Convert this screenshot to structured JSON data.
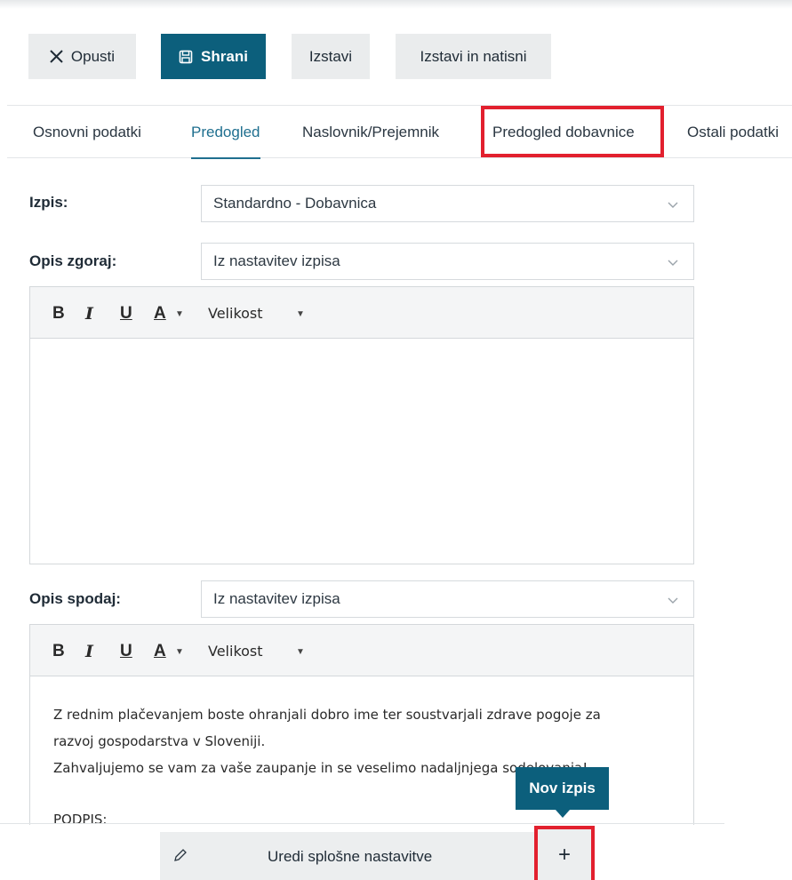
{
  "toolbar": {
    "discard_label": "Opusti",
    "save_label": "Shrani",
    "issue_label": "Izstavi",
    "issue_print_label": "Izstavi in natisni"
  },
  "tabs": [
    {
      "label": "Osnovni podatki"
    },
    {
      "label": "Predogled",
      "active": true
    },
    {
      "label": "Naslovnik/Prejemnik"
    },
    {
      "label": "Predogled dobavnice",
      "highlighted": true
    },
    {
      "label": "Ostali podatki"
    }
  ],
  "form": {
    "print": {
      "label": "Izpis:",
      "value": "Standardno - Dobavnica"
    },
    "desc_top": {
      "label": "Opis zgoraj:",
      "value": "Iz nastavitev izpisa"
    },
    "desc_bottom": {
      "label": "Opis spodaj:",
      "value": "Iz nastavitev izpisa"
    }
  },
  "editor_toolbar": {
    "bold": "B",
    "italic": "I",
    "underline": "U",
    "font_color": "A",
    "size_label": "Velikost"
  },
  "editor_bottom": {
    "lines": [
      "Z rednim plačevanjem boste ohranjali dobro ime ter soustvarjali zdrave pogoje za",
      "razvoj gospodarstva v Sloveniji.",
      "Zahvaljujemo se vam za vaše zaupanje in se veselimo nadaljnjega sodelovanja!",
      "",
      "PODPIS:"
    ]
  },
  "bottom_bar": {
    "edit_label": "Uredi splošne nastavitve",
    "add_label": "+",
    "tooltip": "Nov izpis"
  },
  "colors": {
    "primary": "#0c5f7c",
    "highlight": "#e2202e",
    "active_tab": "#1f6f8f"
  },
  "icons": [
    "close-icon",
    "save-icon",
    "chevron-down-icon",
    "pencil-icon",
    "plus-icon"
  ]
}
